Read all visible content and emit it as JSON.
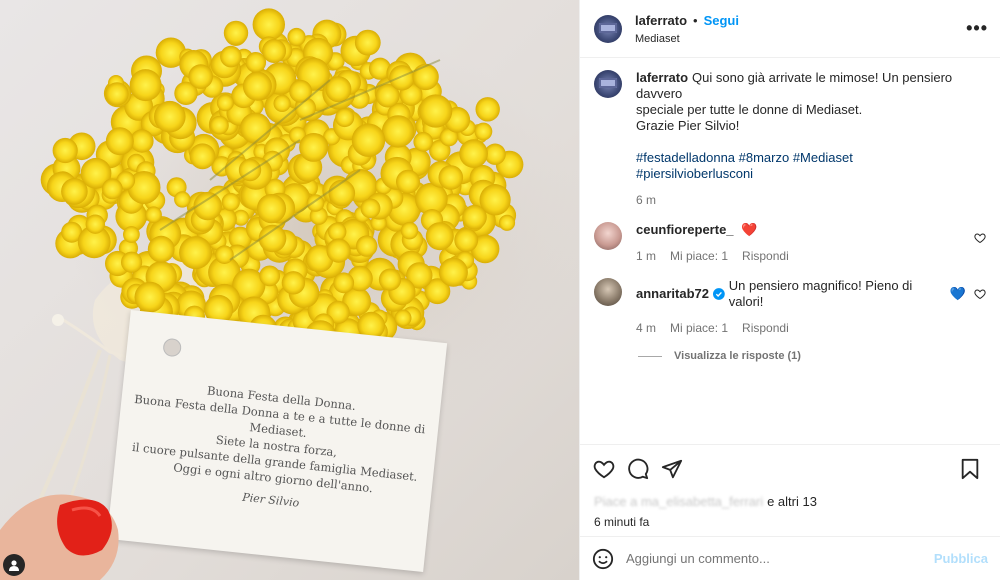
{
  "photo": {
    "card_lines": [
      "Buona Festa della Donna.",
      "Buona Festa della Donna a te e a tutte le donne di Mediaset.",
      "Siete la nostra forza,",
      "il cuore pulsante della grande famiglia Mediaset.",
      "Oggi e ogni altro giorno dell'anno."
    ],
    "card_signature": "Pier Silvio"
  },
  "header": {
    "username": "laferrato",
    "separator": "•",
    "follow_label": "Segui",
    "subtitle": "Mediaset",
    "more_label": "•••"
  },
  "caption": {
    "username": "laferrato",
    "text_line1": "Qui sono già arrivate le mimose! Un pensiero davvero",
    "text_line2": "speciale per tutte le donne di Mediaset.",
    "text_line3": "Grazie Pier Silvio!",
    "hashtags": "#festadelladonna #8marzo #Mediaset #piersilvioberlusconi",
    "time": "6 m"
  },
  "comments": [
    {
      "username": "ceunfioreperte_",
      "text": "",
      "emoji": "❤️",
      "time": "1 m",
      "likes": "Mi piace: 1",
      "reply": "Rispondi"
    },
    {
      "username": "annaritab72",
      "verified": true,
      "text": "Un pensiero magnifico! Pieno di valori!",
      "emoji": "💙",
      "time": "4 m",
      "likes": "Mi piace: 1",
      "reply": "Rispondi",
      "view_replies": "Visualizza le risposte (1)"
    }
  ],
  "likes": {
    "blurred_names": "Piace a ma_elisabetta_ferrari",
    "and_others": "e altri 13",
    "time": "6 minuti fa"
  },
  "add_comment": {
    "placeholder": "Aggiungi un commento...",
    "publish": "Pubblica"
  },
  "colors": {
    "accent": "#0095f6",
    "hashtag": "#00376b",
    "verified": "#0095f6",
    "mimosa": "#f7d51a"
  }
}
